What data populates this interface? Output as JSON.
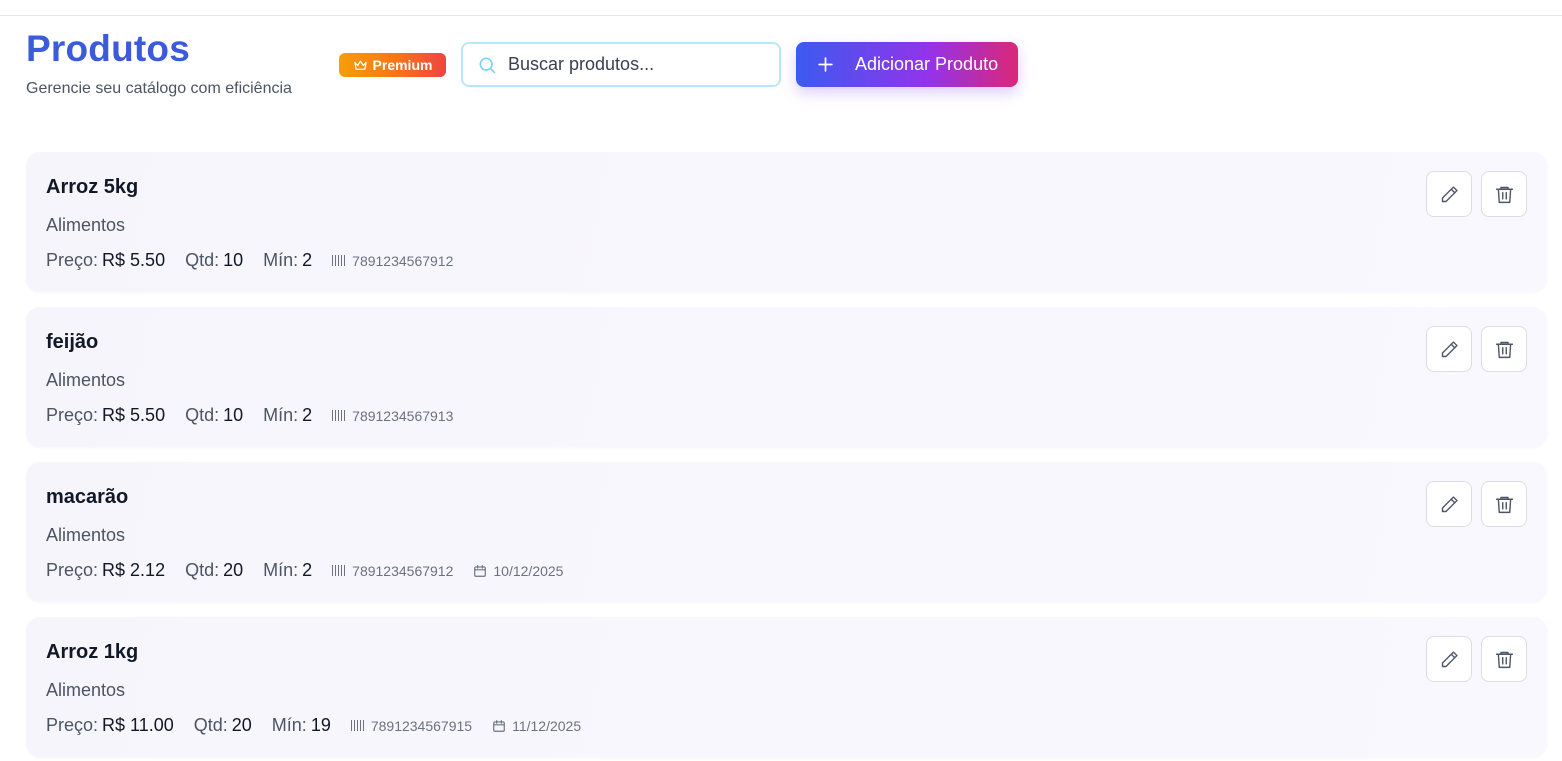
{
  "header": {
    "title": "Produtos",
    "subtitle": "Gerencie seu catálogo com eficiência",
    "badge": "Premium"
  },
  "search": {
    "placeholder": "Buscar produtos...",
    "value": ""
  },
  "add_button": {
    "label": "Adicionar Produto"
  },
  "labels": {
    "price": "Preço:",
    "qty": "Qtd:",
    "min": "Mín:"
  },
  "products": [
    {
      "name": "Arroz 5kg",
      "category": "Alimentos",
      "price": "R$ 5.50",
      "qty": "10",
      "min": "2",
      "barcode": "7891234567912",
      "date": ""
    },
    {
      "name": "feijão",
      "category": "Alimentos",
      "price": "R$ 5.50",
      "qty": "10",
      "min": "2",
      "barcode": "7891234567913",
      "date": ""
    },
    {
      "name": "macarão",
      "category": "Alimentos",
      "price": "R$ 2.12",
      "qty": "20",
      "min": "2",
      "barcode": "7891234567912",
      "date": "10/12/2025"
    },
    {
      "name": "Arroz 1kg",
      "category": "Alimentos",
      "price": "R$ 11.00",
      "qty": "20",
      "min": "19",
      "barcode": "7891234567915",
      "date": "11/12/2025"
    }
  ],
  "colors": {
    "title": "#3b5bdb",
    "badge_gradient": [
      "#f59e0b",
      "#ef4444"
    ],
    "button_gradient": [
      "#3b5bf0",
      "#9333ea",
      "#db2777"
    ],
    "search_border": "#bae6fd"
  },
  "icons": {
    "badge": "crown-icon",
    "search": "search-icon",
    "add": "plus-icon",
    "edit": "pencil-icon",
    "delete": "trash-icon",
    "barcode": "barcode-icon",
    "date": "calendar-icon"
  }
}
